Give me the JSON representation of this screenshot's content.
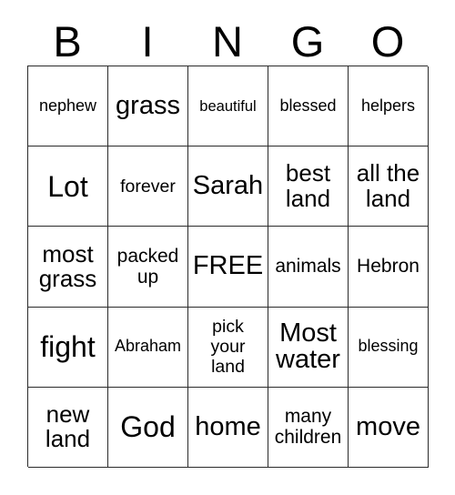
{
  "card": {
    "title": "BINGO card",
    "header_letters": [
      "B",
      "I",
      "N",
      "G",
      "O"
    ],
    "free_space_label": "FREE",
    "colors": {
      "border": "#2b2b2b",
      "background": "#ffffff",
      "text": "#000000"
    },
    "grid": {
      "columns": 5,
      "rows": 5,
      "cells": [
        [
          {
            "text": "nephew",
            "size": "xs"
          },
          {
            "text": "grass",
            "size": "xl"
          },
          {
            "text": "beautiful",
            "size": "xxs"
          },
          {
            "text": "blessed",
            "size": "xs"
          },
          {
            "text": "helpers",
            "size": "xs"
          }
        ],
        [
          {
            "text": "Lot",
            "size": "xxl"
          },
          {
            "text": "forever",
            "size": "s"
          },
          {
            "text": "Sarah",
            "size": "xl"
          },
          {
            "text": "best\nland",
            "size": "l"
          },
          {
            "text": "all the\nland",
            "size": "l"
          }
        ],
        [
          {
            "text": "most\ngrass",
            "size": "l"
          },
          {
            "text": "packed\nup",
            "size": "m"
          },
          {
            "text": "FREE",
            "size": "xl"
          },
          {
            "text": "animals",
            "size": "m"
          },
          {
            "text": "Hebron",
            "size": "m"
          }
        ],
        [
          {
            "text": "fight",
            "size": "xxl"
          },
          {
            "text": "Abraham",
            "size": "xs"
          },
          {
            "text": "pick\nyour\nland",
            "size": "s"
          },
          {
            "text": "Most\nwater",
            "size": "xl"
          },
          {
            "text": "blessing",
            "size": "xs"
          }
        ],
        [
          {
            "text": "new\nland",
            "size": "l"
          },
          {
            "text": "God",
            "size": "xxl"
          },
          {
            "text": "home",
            "size": "xl"
          },
          {
            "text": "many\nchildren",
            "size": "m"
          },
          {
            "text": "move",
            "size": "xl"
          }
        ]
      ]
    }
  }
}
